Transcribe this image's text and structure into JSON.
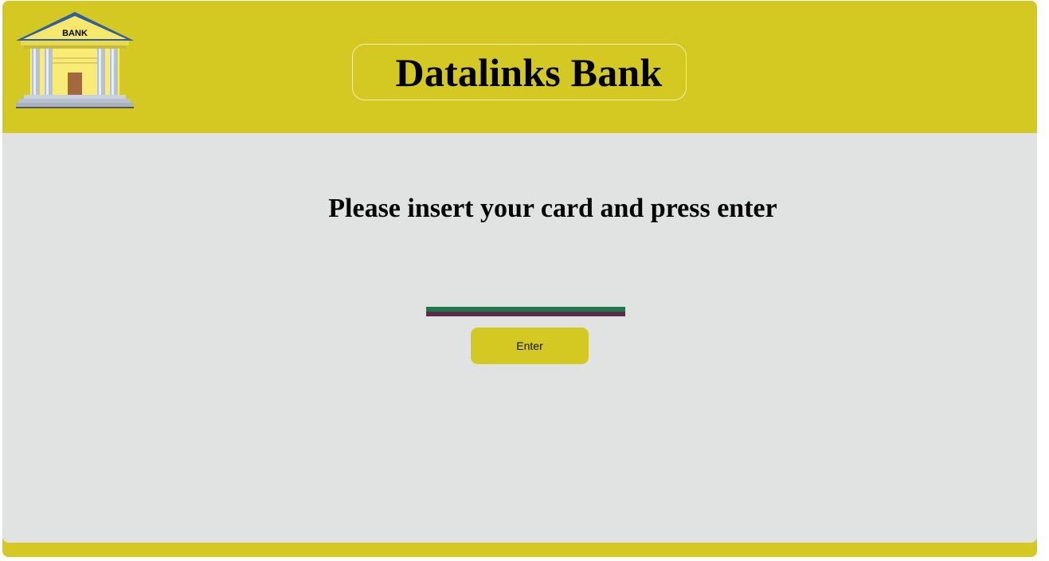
{
  "header": {
    "logo_sign": "BANK",
    "title": "Datalinks Bank",
    "logo_icon": "bank-building-icon"
  },
  "main": {
    "prompt": "Please insert your card and press enter",
    "card_slot_colors": [
      "#1e7a4c",
      "#5e2a48"
    ],
    "enter_label": "Enter"
  },
  "colors": {
    "accent": "#d4c922",
    "panel": "#e1e2e2"
  }
}
